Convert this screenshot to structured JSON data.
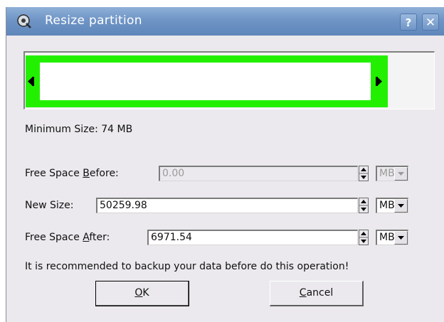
{
  "window": {
    "title": "Resize partition",
    "help_label": "?",
    "close_label": "✕"
  },
  "partition": {
    "minimum_size": "Minimum Size: 74 MB"
  },
  "fields": {
    "before": {
      "label_pre": "Free Space ",
      "label_accel": "B",
      "label_post": "efore:",
      "value": "0.00",
      "unit": "MB",
      "disabled": true
    },
    "new_size": {
      "label": "New Size:",
      "value": "50259.98",
      "unit": "MB"
    },
    "after": {
      "label_pre": "Free Space ",
      "label_accel": "A",
      "label_post": "fter:",
      "value": "6971.54",
      "unit": "MB"
    }
  },
  "note": "It is recommended to backup your data before do this operation!",
  "buttons": {
    "ok": {
      "accel": "O",
      "rest": "K"
    },
    "cancel": {
      "accel": "C",
      "rest": "ancel"
    }
  },
  "colors": {
    "partition_used": "#23f000",
    "titlebar": "#6f95c6"
  },
  "icons": [
    "partition-tool-icon",
    "help-icon",
    "close-icon",
    "resize-left-handle-icon",
    "resize-right-handle-icon",
    "spin-arrows-icon",
    "dropdown-arrow-icon"
  ]
}
